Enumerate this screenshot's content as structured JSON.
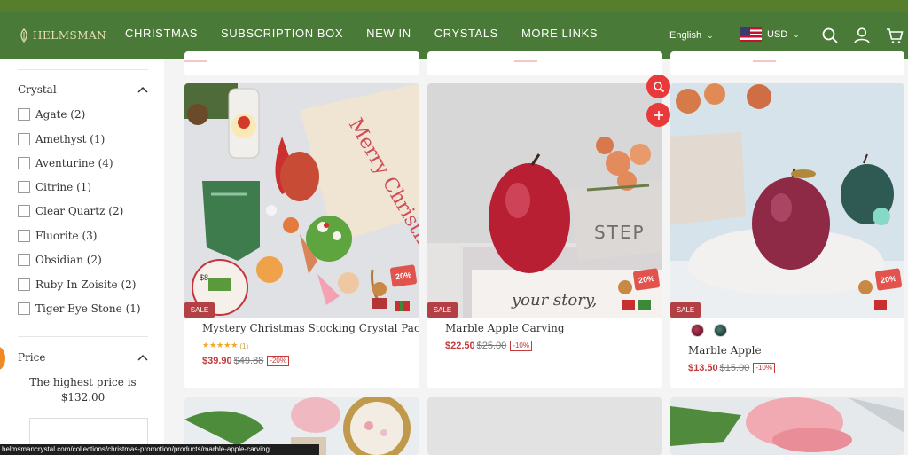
{
  "brand": {
    "name": "HELMSMAN"
  },
  "nav": {
    "links": [
      "CHRISTMAS",
      "SUBSCRIPTION BOX",
      "NEW IN",
      "CRYSTALS",
      "MORE LINKS"
    ],
    "language": "English",
    "currency": "USD"
  },
  "icons": {
    "search": "search-icon",
    "account": "user-icon",
    "cart": "cart-icon",
    "chevron": "chevron-down-icon"
  },
  "colors": {
    "nav_bg": "#4a7a37",
    "sale_badge": "#b34045",
    "price_red": "#c23a3a",
    "fab_red": "#e83a3a"
  },
  "sidebar": {
    "crystal_heading": "Crystal",
    "filters": [
      {
        "label": "Agate",
        "count": "(2)"
      },
      {
        "label": "Amethyst",
        "count": "(1)"
      },
      {
        "label": "Aventurine",
        "count": "(4)"
      },
      {
        "label": "Citrine",
        "count": "(1)"
      },
      {
        "label": "Clear Quartz",
        "count": "(2)"
      },
      {
        "label": "Fluorite",
        "count": "(3)"
      },
      {
        "label": "Obsidian",
        "count": "(2)"
      },
      {
        "label": "Ruby In Zoisite",
        "count": "(2)"
      },
      {
        "label": "Tiger Eye Stone",
        "count": "(1)"
      }
    ],
    "price_heading": "Price",
    "price_text_1": "The highest price is",
    "price_text_2": "$132.00"
  },
  "products": [
    {
      "sale": "SALE",
      "title": "Mystery Christmas Stocking Crystal Pack",
      "rating_count": "(1)",
      "price": "$39.90",
      "was": "$49.88",
      "off": "-20%",
      "image_text": "Merry Christmas",
      "inset_price": "$8",
      "promo": "20%"
    },
    {
      "sale": "SALE",
      "title": "Marble Apple Carving",
      "price": "$22.50",
      "was": "$25.00",
      "off": "-10%",
      "image_text": "STEP",
      "image_text_2": "your story,",
      "promo": "20%"
    },
    {
      "sale": "SALE",
      "title": "Marble Apple",
      "price": "$13.50",
      "was": "$15.00",
      "off": "-10%",
      "promo": "20%"
    }
  ],
  "status_url": "helmsmancrystal.com/collections/christmas-promotion/products/marble-apple-carving"
}
